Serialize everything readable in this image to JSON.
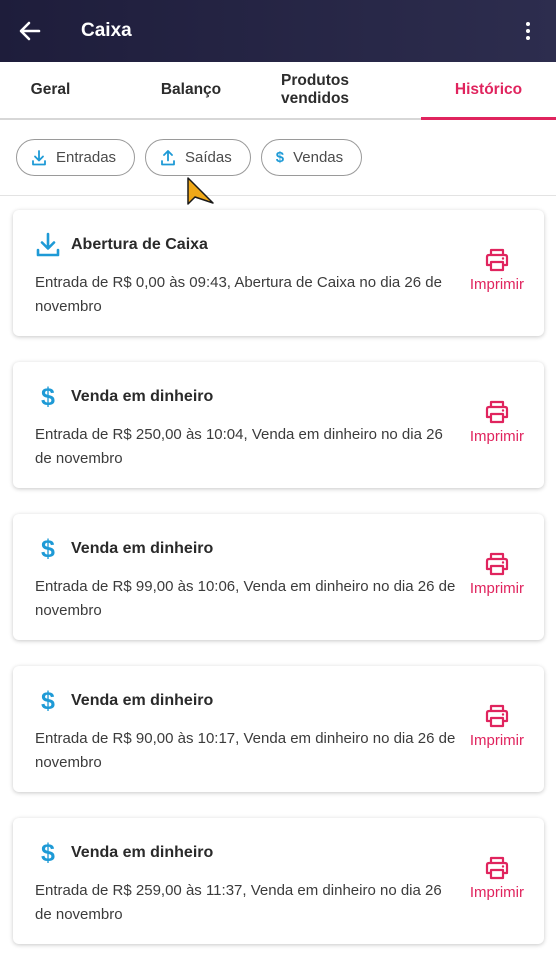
{
  "appbar": {
    "title": "Caixa",
    "back_icon": "arrow-left-icon",
    "menu_icon": "more-vert-icon"
  },
  "tabs": [
    {
      "label": "Geral",
      "active": false
    },
    {
      "label": "Balanço",
      "active": false
    },
    {
      "label": "Produtos vendidos",
      "active": false
    },
    {
      "label": "Histórico",
      "active": true
    }
  ],
  "filters": [
    {
      "label": "Entradas",
      "icon": "download-icon"
    },
    {
      "label": "Saídas",
      "icon": "upload-icon"
    },
    {
      "label": "Vendas",
      "icon": "dollar-icon"
    }
  ],
  "entries": [
    {
      "icon": "download-icon",
      "title": "Abertura de Caixa",
      "description": "Entrada de R$ 0,00 às 09:43, Abertura de Caixa no dia 26 de novembro",
      "action": "Imprimir"
    },
    {
      "icon": "dollar-icon",
      "title": "Venda em dinheiro",
      "description": "Entrada de R$ 250,00 às 10:04, Venda em dinheiro no dia 26 de novembro",
      "action": "Imprimir"
    },
    {
      "icon": "dollar-icon",
      "title": "Venda em dinheiro",
      "description": "Entrada de R$ 99,00 às 10:06, Venda em dinheiro no dia 26 de novembro",
      "action": "Imprimir"
    },
    {
      "icon": "dollar-icon",
      "title": "Venda em dinheiro",
      "description": "Entrada de R$ 90,00 às 10:17, Venda em dinheiro no dia 26 de novembro",
      "action": "Imprimir"
    },
    {
      "icon": "dollar-icon",
      "title": "Venda em dinheiro",
      "description": "Entrada de R$ 259,00 às 11:37, Venda em dinheiro no dia 26 de novembro",
      "action": "Imprimir"
    }
  ],
  "colors": {
    "appbar": "#1e1d3b",
    "accent": "#e0245e",
    "icon_blue": "#1e9ad6"
  }
}
